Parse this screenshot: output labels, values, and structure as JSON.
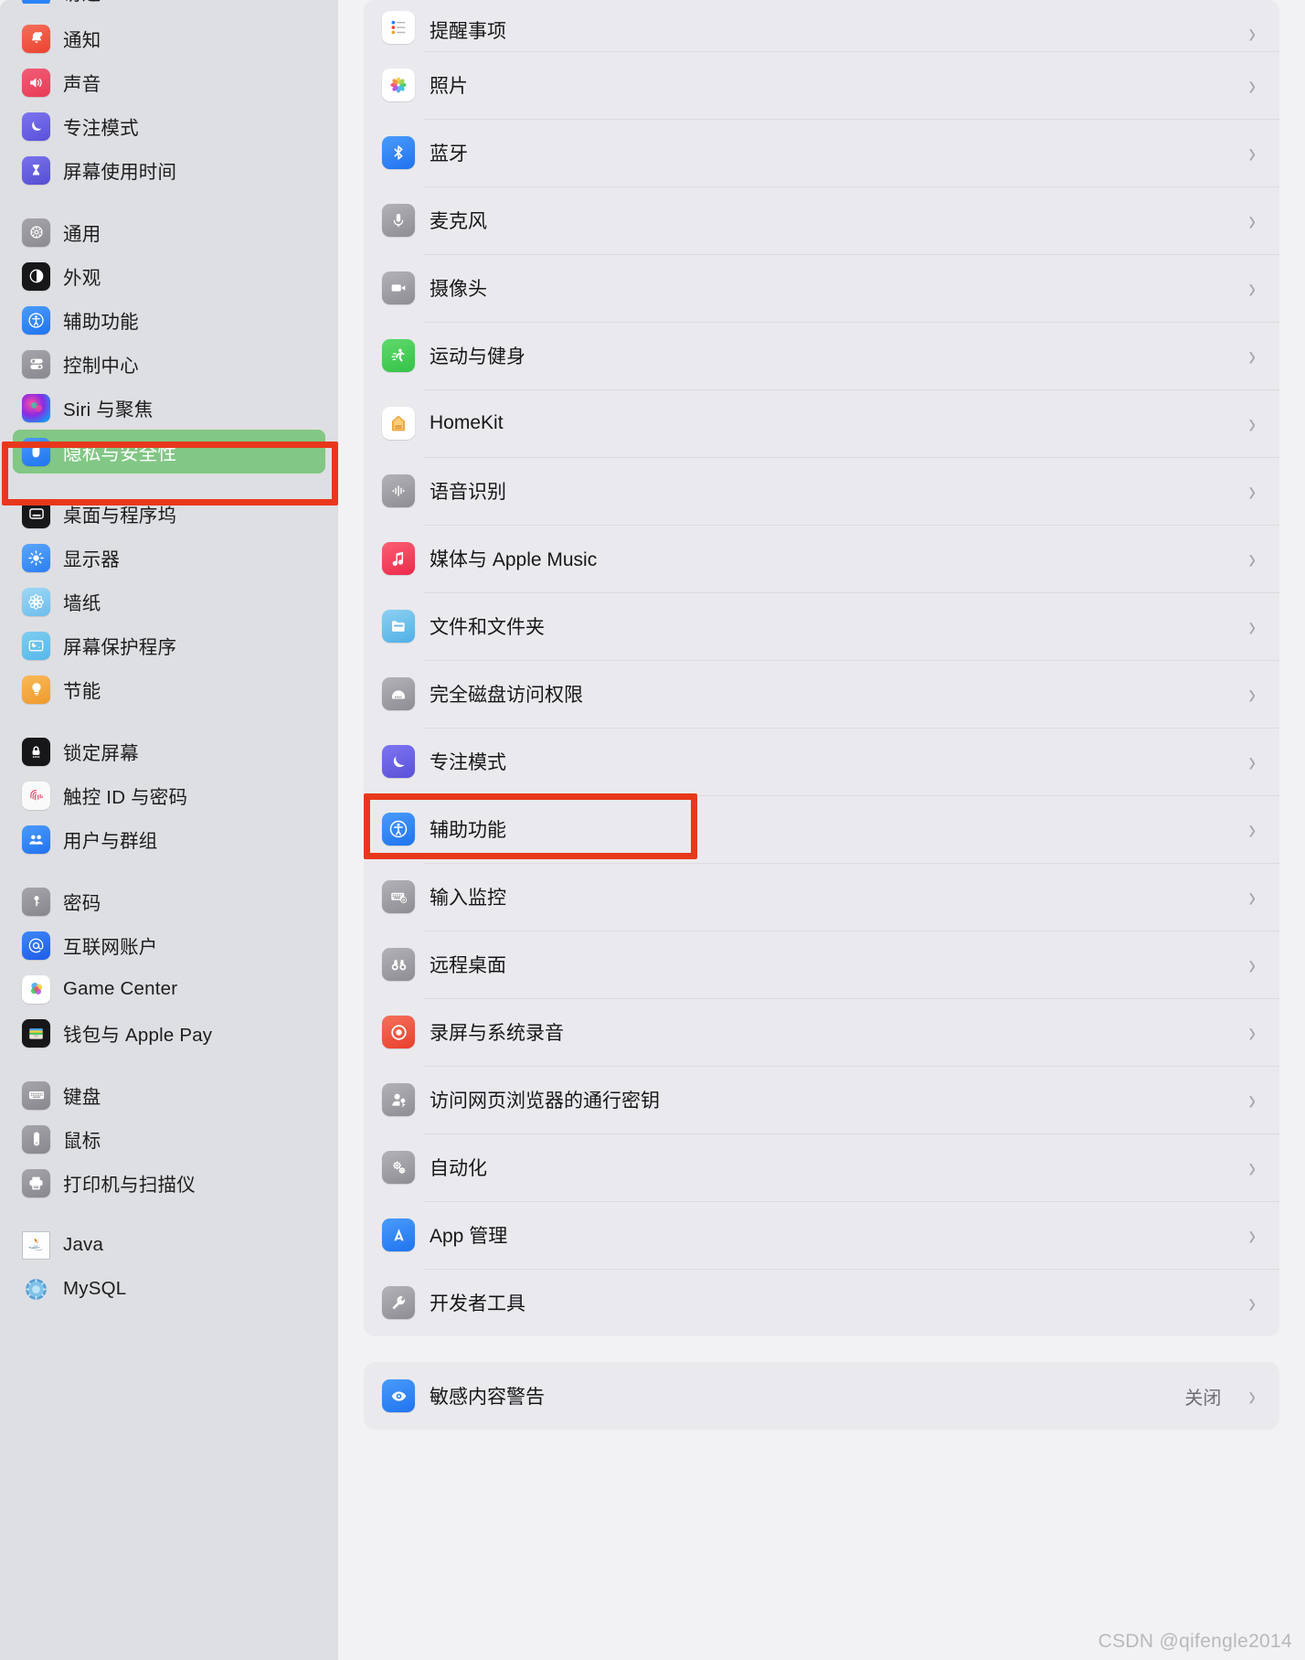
{
  "window": {
    "app": "System Settings",
    "watermark": "CSDN @qifengle2014"
  },
  "sidebar": {
    "partial_top_label": "访达",
    "groups": [
      {
        "items": [
          {
            "label": "通知",
            "icon": "bell-icon",
            "color": "#f0553f"
          },
          {
            "label": "声音",
            "icon": "speaker-icon",
            "color": "#ee4c63"
          },
          {
            "label": "专注模式",
            "icon": "moon-icon",
            "color": "#6b63e8"
          },
          {
            "label": "屏幕使用时间",
            "icon": "hourglass-icon",
            "color": "#6460d9"
          }
        ]
      },
      {
        "items": [
          {
            "label": "通用",
            "icon": "gear-icon",
            "color": "#8e8e93"
          },
          {
            "label": "外观",
            "icon": "appearance-icon",
            "color": "#1c1c1e"
          },
          {
            "label": "辅助功能",
            "icon": "accessibility-icon",
            "color": "#2b83f6"
          },
          {
            "label": "控制中心",
            "icon": "control-center-icon",
            "color": "#8e8e93"
          },
          {
            "label": "Siri 与聚焦",
            "icon": "siri-icon",
            "color": "#7b3fb5"
          },
          {
            "label": "隐私与安全性",
            "icon": "hand-privacy-icon",
            "color": "#2b83f6",
            "selected": true
          }
        ]
      },
      {
        "items": [
          {
            "label": "桌面与程序坞",
            "icon": "desktop-dock-icon",
            "color": "#1c1c1e"
          },
          {
            "label": "显示器",
            "icon": "display-brightness-icon",
            "color": "#3b8cf5"
          },
          {
            "label": "墙纸",
            "icon": "wallpaper-icon",
            "color": "#7cc7ef"
          },
          {
            "label": "屏幕保护程序",
            "icon": "screensaver-icon",
            "color": "#63c4ee"
          },
          {
            "label": "节能",
            "icon": "lightbulb-icon",
            "color": "#f0a43a"
          }
        ]
      },
      {
        "items": [
          {
            "label": "锁定屏幕",
            "icon": "lock-screen-icon",
            "color": "#1c1c1e"
          },
          {
            "label": "触控 ID 与密码",
            "icon": "touchid-icon",
            "color": "#f7f7f8"
          },
          {
            "label": "用户与群组",
            "icon": "users-groups-icon",
            "color": "#3b8cf5"
          }
        ]
      },
      {
        "items": [
          {
            "label": "密码",
            "icon": "key-icon",
            "color": "#8e8e93"
          },
          {
            "label": "互联网账户",
            "icon": "at-sign-icon",
            "color": "#2b6ef0"
          },
          {
            "label": "Game Center",
            "icon": "game-center-icon",
            "color": "#ffffff"
          },
          {
            "label": "钱包与 Apple Pay",
            "icon": "wallet-icon",
            "color": "#1c1c1e"
          }
        ]
      },
      {
        "items": [
          {
            "label": "键盘",
            "icon": "keyboard-icon",
            "color": "#8e8e93"
          },
          {
            "label": "鼠标",
            "icon": "mouse-icon",
            "color": "#8e8e93"
          },
          {
            "label": "打印机与扫描仪",
            "icon": "printer-icon",
            "color": "#8e8e93"
          }
        ]
      },
      {
        "items": [
          {
            "label": "Java",
            "icon": "java-icon",
            "color": "#ffffff"
          },
          {
            "label": "MySQL",
            "icon": "mysql-icon",
            "color": "#ffffff"
          }
        ]
      }
    ]
  },
  "main": {
    "card1": [
      {
        "label": "提醒事项",
        "icon": "reminders-icon",
        "color": "#ffffff"
      },
      {
        "label": "照片",
        "icon": "photos-icon",
        "color": "#ffffff"
      },
      {
        "label": "蓝牙",
        "icon": "bluetooth-icon",
        "color": "#3b8cf5"
      },
      {
        "label": "麦克风",
        "icon": "microphone-icon",
        "color": "#9a9aa0"
      },
      {
        "label": "摄像头",
        "icon": "camera-icon",
        "color": "#9a9aa0"
      },
      {
        "label": "运动与健身",
        "icon": "fitness-icon",
        "color": "#4cd05c"
      },
      {
        "label": "HomeKit",
        "icon": "homekit-icon",
        "color": "#ffffff"
      },
      {
        "label": "语音识别",
        "icon": "speech-recognition-icon",
        "color": "#9a9aa0"
      },
      {
        "label": "媒体与 Apple Music",
        "icon": "apple-music-icon",
        "color": "#f1435b"
      },
      {
        "label": "文件和文件夹",
        "icon": "files-folders-icon",
        "color": "#63c4ee"
      },
      {
        "label": "完全磁盘访问权限",
        "icon": "full-disk-access-icon",
        "color": "#9a9aa0"
      },
      {
        "label": "专注模式",
        "icon": "focus-moon-icon",
        "color": "#6b63e8"
      },
      {
        "label": "辅助功能",
        "icon": "accessibility-icon",
        "color": "#2b83f6",
        "highlighted": true
      },
      {
        "label": "输入监控",
        "icon": "input-monitoring-icon",
        "color": "#9a9aa0"
      },
      {
        "label": "远程桌面",
        "icon": "remote-desktop-icon",
        "color": "#9a9aa0"
      },
      {
        "label": "录屏与系统录音",
        "icon": "screen-recording-icon",
        "color": "#ef4b3b"
      },
      {
        "label": "访问网页浏览器的通行密钥",
        "icon": "passkey-access-icon",
        "color": "#9a9aa0"
      },
      {
        "label": "自动化",
        "icon": "automation-icon",
        "color": "#9a9aa0"
      },
      {
        "label": "App 管理",
        "icon": "app-management-icon",
        "color": "#3b8cf5"
      },
      {
        "label": "开发者工具",
        "icon": "developer-tools-icon",
        "color": "#9a9aa0"
      }
    ],
    "card2": [
      {
        "label": "敏感内容警告",
        "icon": "sensitive-content-icon",
        "color": "#3b8cf5",
        "value": "关闭"
      }
    ]
  },
  "annotations": {
    "box_color": "#e8381c",
    "sidebar_highlight_color": "#82c785",
    "sidebar_highlight_target": "隐私与安全性",
    "main_highlight_target": "辅助功能"
  }
}
